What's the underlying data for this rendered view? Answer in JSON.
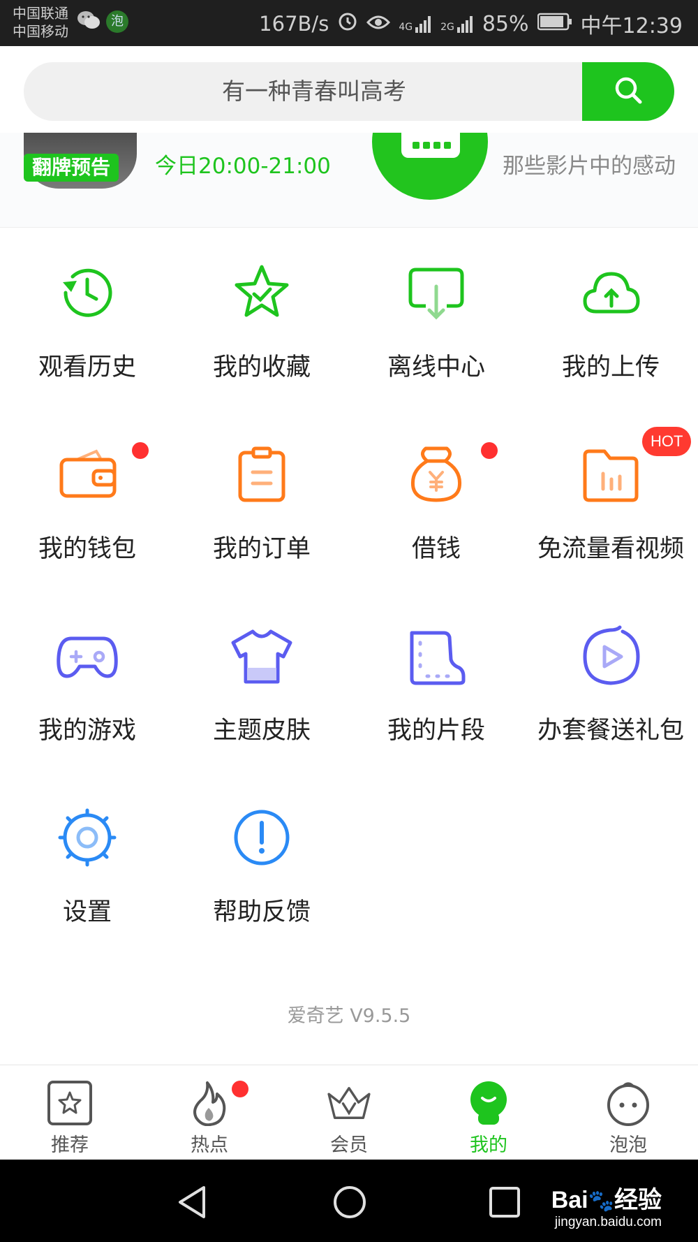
{
  "status_bar": {
    "carrier_1": "中国联通",
    "carrier_2": "中国移动",
    "wechat_icon": "wechat-icon",
    "paopao_icon_label": "泡",
    "net_speed": "167B/s",
    "net_4g": "4G",
    "net_2g": "2G",
    "battery": "85%",
    "clock": "中午12:39"
  },
  "search": {
    "placeholder": "有一种青春叫高考",
    "icon": "search-icon"
  },
  "banner": {
    "badge": "翻牌预告",
    "time": "今日20:00-21:00",
    "description": "那些影片中的感动"
  },
  "menu_rows": [
    [
      {
        "label": "观看历史",
        "icon": "history-clock-icon",
        "color": "#1ec41e"
      },
      {
        "label": "我的收藏",
        "icon": "star-icon",
        "color": "#1ec41e"
      },
      {
        "label": "离线中心",
        "icon": "download-icon",
        "color": "#1ec41e"
      },
      {
        "label": "我的上传",
        "icon": "cloud-upload-icon",
        "color": "#1ec41e"
      }
    ],
    [
      {
        "label": "我的钱包",
        "icon": "wallet-icon",
        "color": "#ff7a1a"
      },
      {
        "label": "我的订单",
        "icon": "clipboard-icon",
        "color": "#ff7a1a"
      },
      {
        "label": "借钱",
        "icon": "money-bag-icon",
        "color": "#ff7a1a"
      },
      {
        "label": "免流量看视频",
        "icon": "data-folder-icon",
        "color": "#ff7a1a"
      }
    ],
    [
      {
        "label": "我的游戏",
        "icon": "gamepad-icon",
        "color": "#5b5cf0"
      },
      {
        "label": "主题皮肤",
        "icon": "tshirt-icon",
        "color": "#5b5cf0"
      },
      {
        "label": "我的片段",
        "icon": "film-clip-icon",
        "color": "#5b5cf0"
      },
      {
        "label": "办套餐送礼包",
        "icon": "play-circle-icon",
        "color": "#5b5cf0"
      }
    ],
    [
      {
        "label": "设置",
        "icon": "settings-gear-icon",
        "color": "#2a8af5"
      },
      {
        "label": "帮助反馈",
        "icon": "help-exclamation-icon",
        "color": "#2a8af5"
      }
    ]
  ],
  "hot_badge": "HOT",
  "version": "爱奇艺 V9.5.5",
  "tabs": [
    {
      "label": "推荐",
      "icon": "recommend-star-icon"
    },
    {
      "label": "热点",
      "icon": "fire-icon"
    },
    {
      "label": "会员",
      "icon": "crown-icon"
    },
    {
      "label": "我的",
      "icon": "profile-icon",
      "active": true
    },
    {
      "label": "泡泡",
      "icon": "bubble-face-icon"
    }
  ],
  "watermark": {
    "brand": "Bai",
    "brand_cn": "经验",
    "url": "jingyan.baidu.com"
  },
  "colors": {
    "brand_green": "#1ec41e",
    "orange": "#ff7a1a",
    "purple": "#5b5cf0",
    "blue": "#2a8af5",
    "badge_red": "#ff3a30"
  }
}
